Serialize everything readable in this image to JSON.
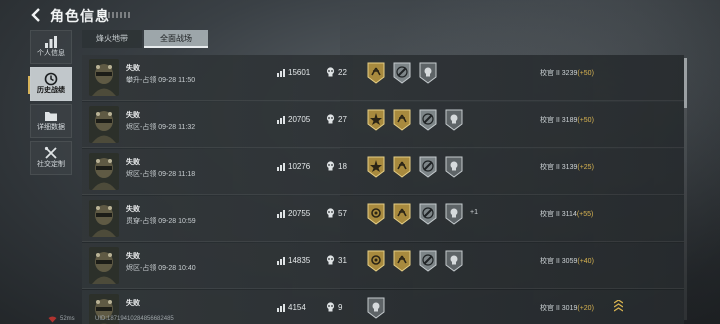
{
  "header": {
    "title": "角色信息"
  },
  "sidebar": {
    "items": [
      {
        "label": "个人信息",
        "icon": "bar-chart-icon",
        "active": false
      },
      {
        "label": "历史战绩",
        "icon": "clock-icon",
        "active": true
      },
      {
        "label": "详细数据",
        "icon": "folder-icon",
        "active": false
      },
      {
        "label": "社交定制",
        "icon": "tools-icon",
        "active": false
      }
    ]
  },
  "tabs": [
    {
      "label": "烽火地带",
      "active": false
    },
    {
      "label": "全面战场",
      "active": true
    }
  ],
  "matches": [
    {
      "result": "失败",
      "info": "攀升-占领 09-28 11:50",
      "score": "15601",
      "kills": "22",
      "badges": [
        "gold-wings",
        "silver-wrench",
        "grey-skull"
      ],
      "extra": "",
      "rank": "校官 II 3239",
      "delta": "(+50)"
    },
    {
      "result": "失败",
      "info": "烬区-占领 09-28 11:32",
      "score": "20705",
      "kills": "27",
      "badges": [
        "gold-star",
        "gold-wings",
        "silver-wrench",
        "grey-skull"
      ],
      "extra": "",
      "rank": "校官 II 3189",
      "delta": "(+50)"
    },
    {
      "result": "失败",
      "info": "烬区-占领 09-28 11:18",
      "score": "10276",
      "kills": "18",
      "badges": [
        "gold-star",
        "gold-wings",
        "silver-wrench",
        "grey-skull"
      ],
      "extra": "",
      "rank": "校官 II 3139",
      "delta": "(+25)"
    },
    {
      "result": "失败",
      "info": "贯穿-占领 09-28 10:59",
      "score": "20755",
      "kills": "57",
      "badges": [
        "gold-wreath",
        "gold-wings",
        "silver-wrench",
        "grey-skull"
      ],
      "extra": "+1",
      "rank": "校官 II 3114",
      "delta": "(+55)"
    },
    {
      "result": "失败",
      "info": "烬区-占领 09-28 10:40",
      "score": "14835",
      "kills": "31",
      "badges": [
        "gold-wreath",
        "gold-wings",
        "silver-wrench",
        "grey-skull"
      ],
      "extra": "",
      "rank": "校官 II 3059",
      "delta": "(+40)"
    },
    {
      "result": "失败",
      "info": "",
      "score": "4154",
      "kills": "9",
      "badges": [
        "grey-skull"
      ],
      "extra": "",
      "rank": "校官 II 3019",
      "delta": "(+20)"
    }
  ],
  "footer": {
    "ping": "52ms",
    "uid": "UID:18719410284856682485"
  },
  "colors": {
    "accent_gold": "#d9b451",
    "badge_gold": "#a88a3e",
    "badge_silver": "#7d8588"
  }
}
